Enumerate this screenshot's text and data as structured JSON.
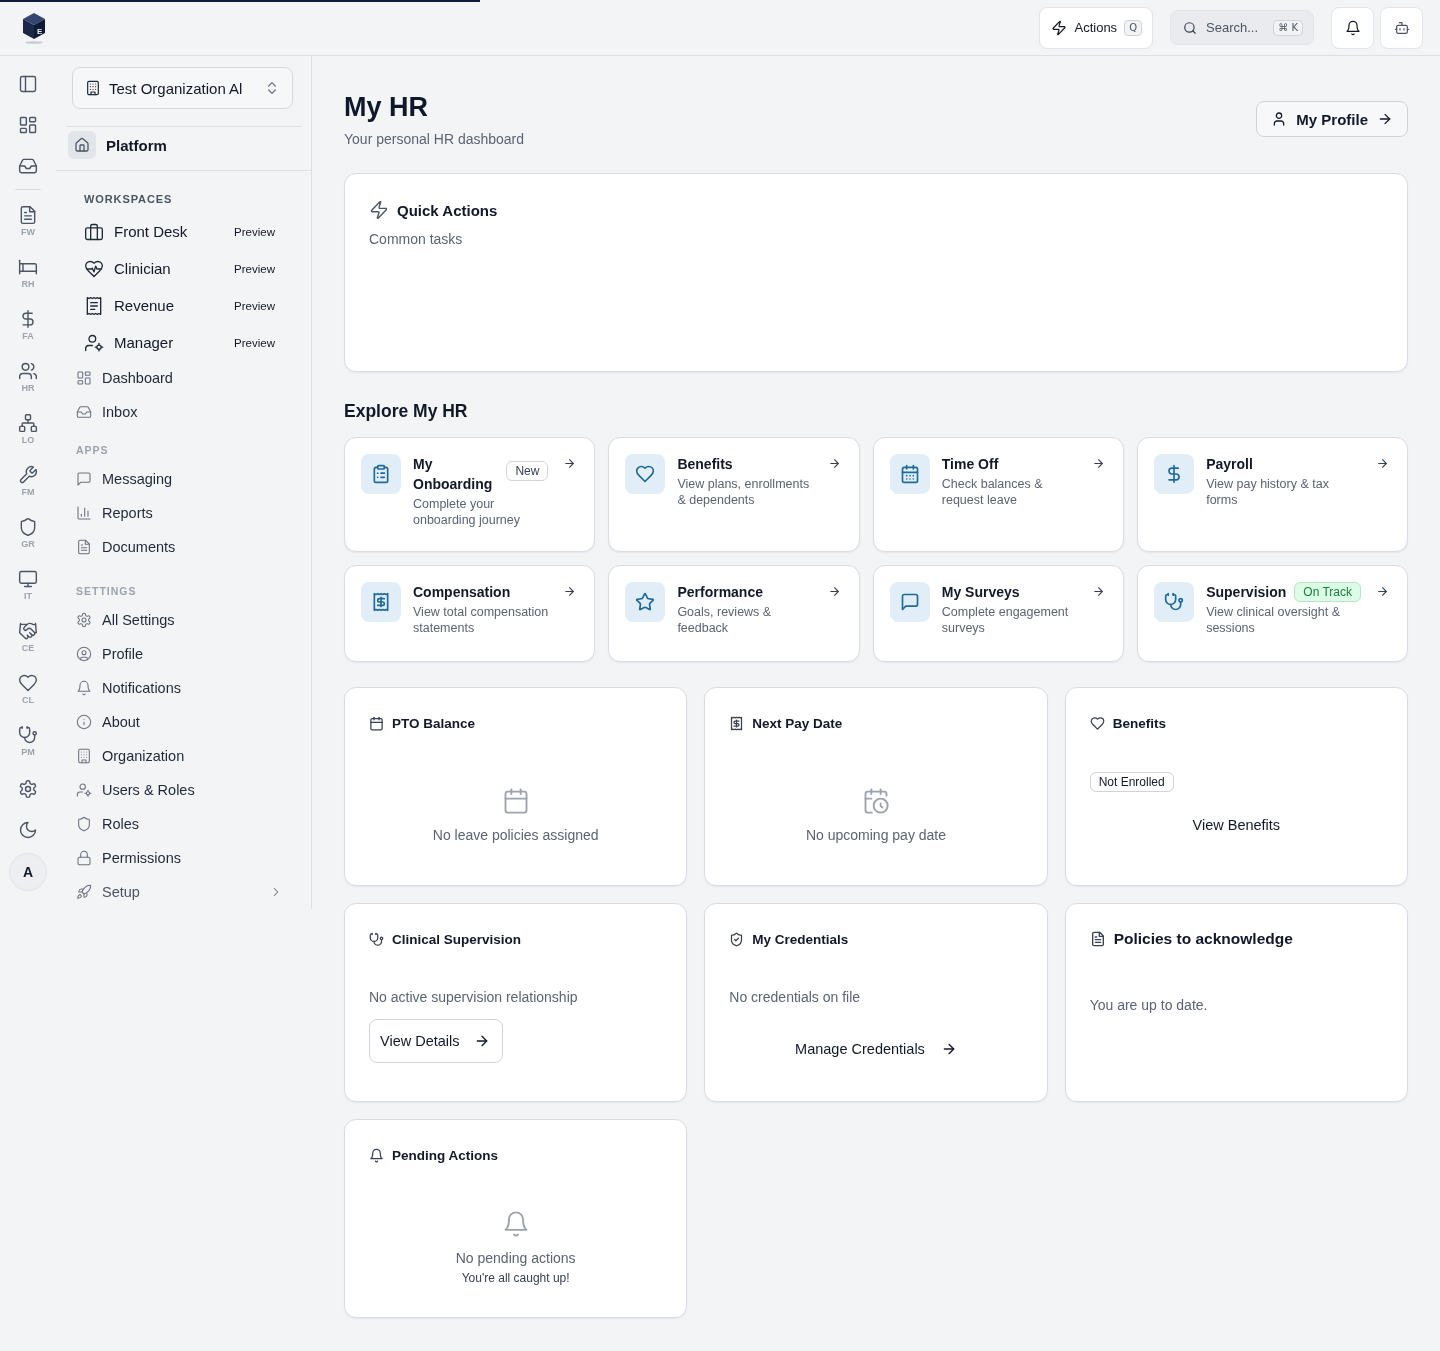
{
  "loading_bar": {
    "level": 0.333
  },
  "top_bar": {
    "logo_letter": "E",
    "actions": {
      "label": "Actions",
      "shortcut": "Q"
    },
    "search": {
      "placeholder": "Search...",
      "shortcut": "⌘ K"
    }
  },
  "rail": {
    "apps": [
      {
        "label": "FW"
      },
      {
        "label": "RH"
      },
      {
        "label": "FA"
      },
      {
        "label": "HR"
      },
      {
        "label": "LO"
      },
      {
        "label": "FM"
      },
      {
        "label": "GR"
      },
      {
        "label": "IT"
      },
      {
        "label": "CE"
      },
      {
        "label": "CL"
      },
      {
        "label": "PM"
      }
    ],
    "avatar_initial": "A"
  },
  "sidebar": {
    "organization": "Test Organization Al",
    "platform": "Platform",
    "groups": [
      {
        "kind": "workspaces",
        "heading": "WORKSPACES",
        "workspaces": [
          {
            "label": "Front Desk",
            "badge": "Preview"
          },
          {
            "label": "Clinician",
            "badge": "Preview"
          },
          {
            "label": "Revenue",
            "badge": "Preview"
          },
          {
            "label": "Manager",
            "badge": "Preview"
          }
        ],
        "items": [
          {
            "label": "Dashboard",
            "kind": "link"
          },
          {
            "label": "Inbox",
            "kind": "link"
          }
        ]
      },
      {
        "kind": "section",
        "heading": "APPS",
        "items": [
          {
            "label": "Messaging",
            "kind": "link"
          },
          {
            "label": "Reports",
            "kind": "link"
          },
          {
            "label": "Documents",
            "kind": "link"
          }
        ]
      },
      {
        "kind": "section",
        "heading": "SETTINGS",
        "items": [
          {
            "label": "All Settings",
            "kind": "link"
          },
          {
            "label": "Profile",
            "kind": "link"
          },
          {
            "label": "Notifications",
            "kind": "link"
          },
          {
            "label": "About",
            "kind": "link"
          },
          {
            "label": "Organization",
            "kind": "link"
          },
          {
            "label": "Users & Roles",
            "kind": "link"
          },
          {
            "label": "Roles",
            "kind": "link"
          },
          {
            "label": "Permissions",
            "kind": "link"
          },
          {
            "label": "Setup",
            "kind": "submenu"
          }
        ]
      }
    ]
  },
  "main": {
    "title": "My HR",
    "subtitle": "Your personal HR dashboard",
    "profile_button": "My Profile",
    "quick_actions": {
      "title": "Quick Actions",
      "subtitle": "Common tasks"
    },
    "explore": {
      "heading": "Explore My HR",
      "cards": [
        {
          "title": "My Onboarding",
          "description": "Complete your onboarding journey",
          "badge": {
            "label": "New",
            "kind": "neutral"
          }
        },
        {
          "title": "Benefits",
          "description": "View plans, enrollments & dependents"
        },
        {
          "title": "Time Off",
          "description": "Check balances & request leave"
        },
        {
          "title": "Payroll",
          "description": "View pay history & tax forms"
        },
        {
          "title": "Compensation",
          "description": "View total compensation statements"
        },
        {
          "title": "Performance",
          "description": "Goals, reviews & feedback"
        },
        {
          "title": "My Surveys",
          "description": "Complete engagement surveys"
        },
        {
          "title": "Supervision",
          "description": "View clinical oversight & sessions",
          "badge": {
            "label": "On Track",
            "kind": "success"
          }
        }
      ]
    },
    "widgets": [
      {
        "kind": "empty",
        "title": "PTO Balance",
        "message": "No leave policies assigned"
      },
      {
        "kind": "empty",
        "title": "Next Pay Date",
        "message": "No upcoming pay date"
      },
      {
        "kind": "status",
        "title": "Benefits",
        "badge": "Not Enrolled",
        "button": {
          "label": "View Benefits",
          "kind": "ghost",
          "arrow": false
        }
      },
      {
        "kind": "action",
        "title": "Clinical Supervision",
        "message": "No active supervision relationship",
        "button": {
          "label": "View Details",
          "kind": "outline",
          "arrow": true
        }
      },
      {
        "kind": "action",
        "title": "My Credentials",
        "message": "No credentials on file",
        "button": {
          "label": "Manage Credentials",
          "kind": "ghost",
          "arrow": true
        }
      },
      {
        "kind": "notice",
        "title": "Policies to acknowledge",
        "message": "You are up to date."
      },
      {
        "kind": "empty",
        "title": "Pending Actions",
        "message": "No pending actions",
        "sub_message": "You're all caught up!"
      }
    ]
  }
}
